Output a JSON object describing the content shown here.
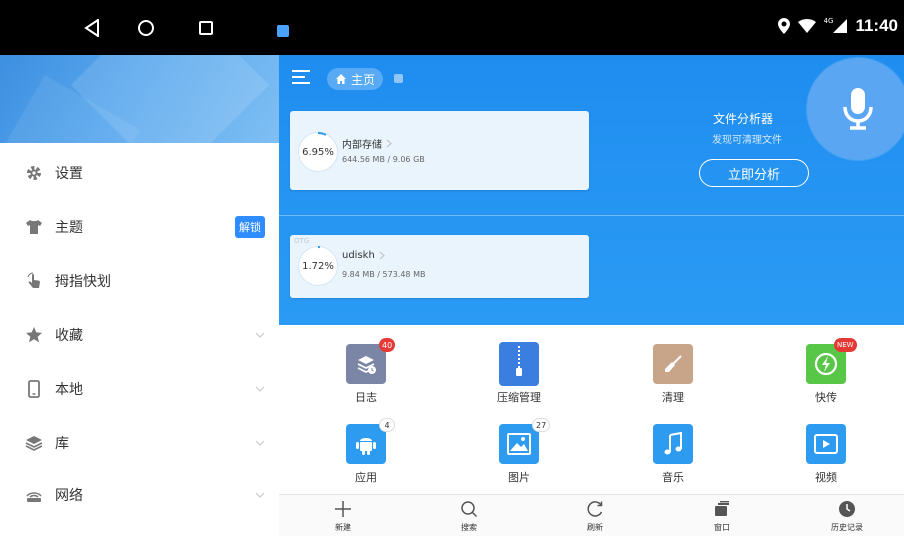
{
  "status_bar": {
    "time": "11:40",
    "network": "4G"
  },
  "sidebar": {
    "items": [
      {
        "label": "设置",
        "icon": "gear-icon"
      },
      {
        "label": "主题",
        "icon": "shirt-icon",
        "badge": "解锁"
      },
      {
        "label": "拇指快划",
        "icon": "gesture-icon"
      },
      {
        "label": "收藏",
        "icon": "star-icon"
      },
      {
        "label": "本地",
        "icon": "phone-icon"
      },
      {
        "label": "库",
        "icon": "layers-icon"
      },
      {
        "label": "网络",
        "icon": "network-icon"
      }
    ]
  },
  "header": {
    "home_label": "主页"
  },
  "storage": {
    "internal": {
      "percent": "6.95%",
      "name": "内部存储",
      "size": "644.56 MB / 9.06 GB"
    },
    "usb": {
      "tag": "OTG",
      "percent": "1.72%",
      "name": "udiskh",
      "size": "9.84 MB / 573.48 MB"
    }
  },
  "analyzer": {
    "title": "文件分析器",
    "subtitle": "发现可清理文件",
    "button": "立即分析"
  },
  "apps": [
    {
      "label": "日志",
      "badge": "40",
      "color": "#7b86a6"
    },
    {
      "label": "压缩管理",
      "color": "#3a7fe0"
    },
    {
      "label": "清理",
      "color": "#c8a588"
    },
    {
      "label": "快传",
      "badge": "NEW",
      "color": "#58c646"
    },
    {
      "label": "应用",
      "badge": "4",
      "color": "#2c9bf0"
    },
    {
      "label": "图片",
      "badge": "27",
      "color": "#2c9bf0"
    },
    {
      "label": "音乐",
      "color": "#2c9bf0"
    },
    {
      "label": "视频",
      "color": "#2c9bf0"
    }
  ],
  "toolbar": [
    {
      "label": "新建",
      "icon": "plus-icon"
    },
    {
      "label": "搜索",
      "icon": "search-icon"
    },
    {
      "label": "刷新",
      "icon": "refresh-icon"
    },
    {
      "label": "窗口",
      "icon": "windows-icon"
    },
    {
      "label": "历史记录",
      "icon": "history-icon"
    }
  ],
  "colors": {
    "primary_blue": "#1f8df0",
    "badge_red": "#e53935",
    "unlock_blue": "#2f8cff"
  }
}
